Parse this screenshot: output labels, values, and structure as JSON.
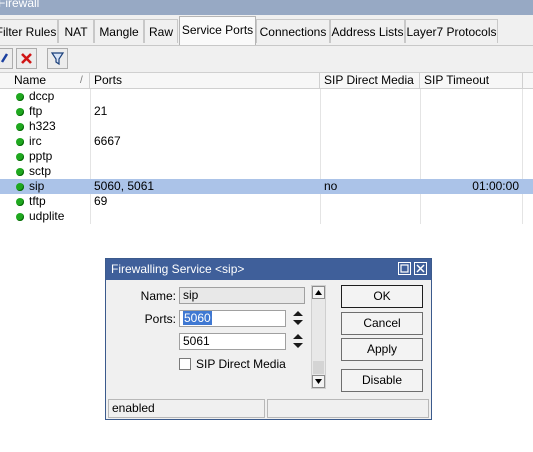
{
  "window": {
    "title": "Firewall"
  },
  "tabs": [
    {
      "label": "Filter Rules"
    },
    {
      "label": "NAT"
    },
    {
      "label": "Mangle"
    },
    {
      "label": "Raw"
    },
    {
      "label": "Service Ports"
    },
    {
      "label": "Connections"
    },
    {
      "label": "Address Lists"
    },
    {
      "label": "Layer7 Protocols"
    }
  ],
  "toolbar": {
    "enable_icon": "check-icon",
    "disable_icon": "x-icon",
    "filter_icon": "filter-icon"
  },
  "table": {
    "columns": [
      "Name",
      "Ports",
      "SIP Direct Media",
      "SIP Timeout"
    ],
    "sort_indicator": "/",
    "rows": [
      {
        "name": "dccp",
        "ports": "",
        "sip_direct_media": "",
        "sip_timeout": "",
        "selected": false
      },
      {
        "name": "ftp",
        "ports": "21",
        "sip_direct_media": "",
        "sip_timeout": "",
        "selected": false
      },
      {
        "name": "h323",
        "ports": "",
        "sip_direct_media": "",
        "sip_timeout": "",
        "selected": false
      },
      {
        "name": "irc",
        "ports": "6667",
        "sip_direct_media": "",
        "sip_timeout": "",
        "selected": false
      },
      {
        "name": "pptp",
        "ports": "",
        "sip_direct_media": "",
        "sip_timeout": "",
        "selected": false
      },
      {
        "name": "sctp",
        "ports": "",
        "sip_direct_media": "",
        "sip_timeout": "",
        "selected": false
      },
      {
        "name": "sip",
        "ports": "5060, 5061",
        "sip_direct_media": "no",
        "sip_timeout": "01:00:00",
        "selected": true
      },
      {
        "name": "tftp",
        "ports": "69",
        "sip_direct_media": "",
        "sip_timeout": "",
        "selected": false
      },
      {
        "name": "udplite",
        "ports": "",
        "sip_direct_media": "",
        "sip_timeout": "",
        "selected": false
      }
    ]
  },
  "dialog": {
    "title": "Firewalling Service <sip>",
    "name_label": "Name:",
    "name_value": "sip",
    "ports_label": "Ports:",
    "port1": "5060",
    "port2": "5061",
    "sip_direct_media_label": "SIP Direct Media",
    "sip_direct_media_checked": false,
    "buttons": {
      "ok": "OK",
      "cancel": "Cancel",
      "apply": "Apply",
      "disable": "Disable"
    },
    "status": {
      "left": "enabled",
      "right": ""
    }
  },
  "colors": {
    "selection": "#abc3e8",
    "enabled_dot": "#1fa81f",
    "dialog_title_bg": "#3f5f9a"
  }
}
